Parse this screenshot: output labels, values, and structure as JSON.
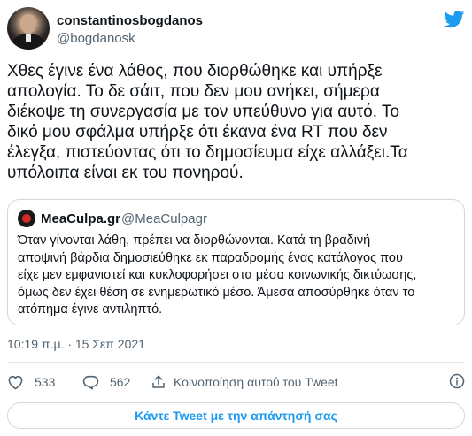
{
  "author": {
    "name": "constantinosbogdanos",
    "handle": "@bogdanosk"
  },
  "tweet_text": "Χθες έγινε ένα λάθος, που διορθώθηκε και υπήρξε\nαπολογία. Το δε σάιτ, που δεν μου ανήκει, σήμερα\nδιέκοψε τη συνεργασία με τον υπεύθυνο για αυτό. Το\nδικό μου σφάλμα υπήρξε ότι έκανα ένα RT που δεν\nέλεγξα, πιστεύοντας ότι το δημοσίευμα είχε αλλάξει.Τα\nυπόλοιπα είναι εκ του πονηρού.",
  "quote": {
    "name": "MeaCulpa.gr",
    "handle": "@MeaCulpagr",
    "text": "Όταν γίνονται λάθη, πρέπει να διορθώνονται. Κατά τη βραδινή\nαποψινή βάρδια δημοσιεύθηκε εκ παραδρομής ένας κατάλογος που\nείχε μεν εμφανιστεί και κυκλοφορήσει στα μέσα κοινωνικής δικτύωσης,\nόμως δεν έχει θέση σε ενημερωτικό μέσο. Άμεσα αποσύρθηκε όταν το\nατόπημα έγινε αντιληπτό."
  },
  "timestamp": "10:19 π.μ. · 15 Σεπ 2021",
  "actions": {
    "likes": "533",
    "replies": "562",
    "share_label": "Κοινοποίηση αυτού του Tweet"
  },
  "reply_button": "Κάντε Tweet με την απάντησή σας",
  "colors": {
    "accent": "#1d9bf0",
    "muted": "#536471",
    "border": "#cfd9de"
  },
  "icons": [
    "twitter-bird-icon",
    "heart-icon",
    "reply-icon",
    "share-icon",
    "info-icon"
  ]
}
